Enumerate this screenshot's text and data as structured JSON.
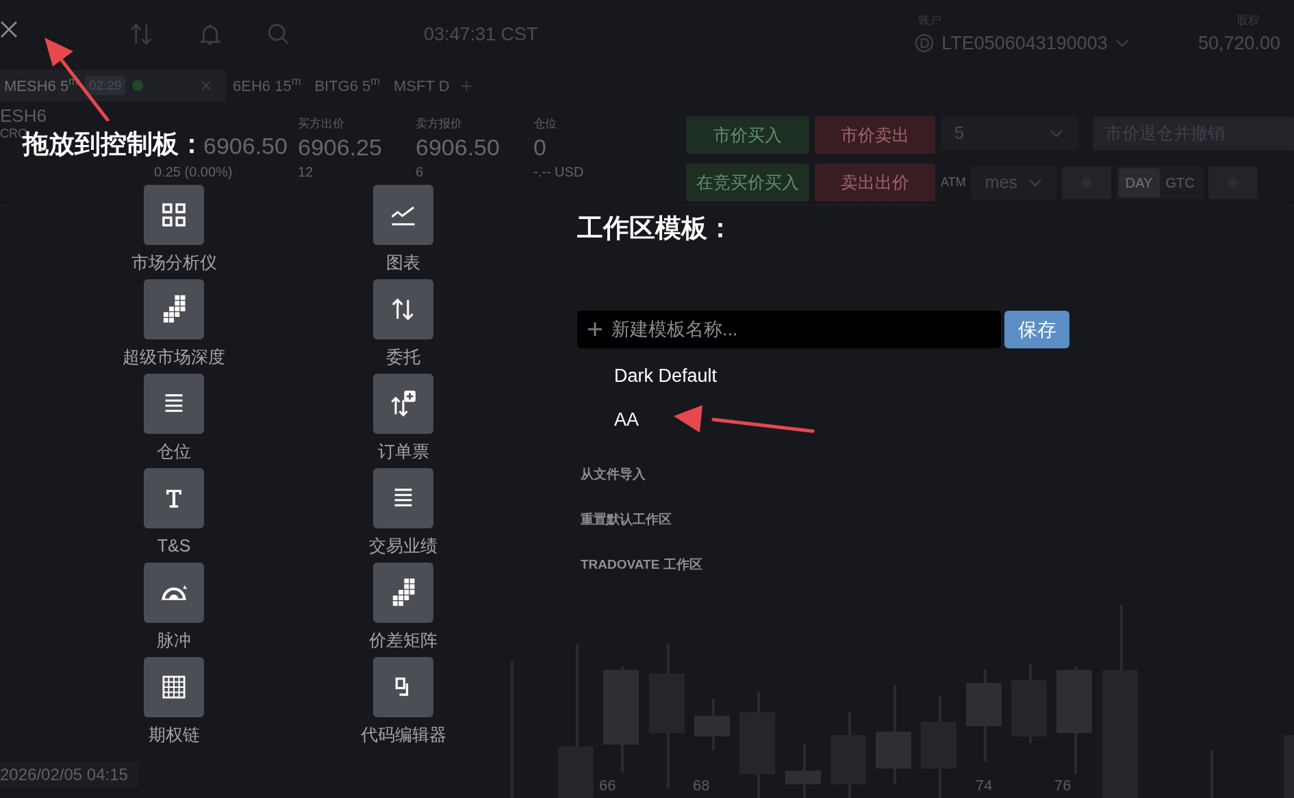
{
  "top_bar": {
    "time": "03:47:31 CST",
    "account_label": "账户",
    "account": "LTE0506043190003",
    "equity_label": "股权",
    "equity": "50,720.00"
  },
  "chart_tabs": [
    {
      "label": "MESH6 5$^{m}$",
      "timer": "02:29",
      "selected": true
    },
    {
      "label": "6EH6 15$^{m}$",
      "selected": false
    },
    {
      "label": "BITG6 5$^{m}$",
      "selected": false
    },
    {
      "label": "MSFT D",
      "selected": false
    }
  ],
  "add_tab": "+",
  "quote": {
    "symbol": "ESH6",
    "exchange": "CRO",
    "last": "6906.50",
    "change": "0.25 (0.00%)",
    "columns": [
      {
        "label": "买方出价",
        "value": "6906.25",
        "sub": "12"
      },
      {
        "label": "卖方报价",
        "value": "6906.50",
        "sub": "6"
      },
      {
        "label": "仓位",
        "value": "0",
        "sub": "-.-- USD"
      }
    ]
  },
  "order_buttons": [
    {
      "label": "市价买入",
      "kind": "buy"
    },
    {
      "label": "市价卖出",
      "kind": "sell"
    },
    {
      "label": "在竞买价买入",
      "kind": "buy"
    },
    {
      "label": "卖出出价",
      "kind": "sell"
    }
  ],
  "quantity": "5",
  "flatten": "市价退仓并撤销",
  "atm_label": "ATM",
  "atm_strategy": "mes",
  "tif": [
    {
      "label": "DAY",
      "selected": true
    },
    {
      "label": "GTC",
      "selected": false
    }
  ],
  "palette": {
    "title": "拖放到控制板：",
    "modules": [
      "市场分析仪",
      "图表",
      "超级市场深度",
      "委托",
      "仓位",
      "订单票",
      "T&S",
      "交易业绩",
      "脉冲",
      "价差矩阵",
      "期权链",
      "代码编辑器"
    ]
  },
  "templates": {
    "title": "工作区模板：",
    "placeholder": "新建模板名称...",
    "save": "保存",
    "items": [
      "Dark Default",
      "AA"
    ],
    "actions": [
      "从文件导入",
      "重置默认工作区",
      "TRADOVATE 工作区"
    ]
  },
  "chart": {
    "timestamp": "2026/02/05 04:15",
    "price_labels": [
      "66",
      "68",
      "74",
      "76"
    ]
  }
}
